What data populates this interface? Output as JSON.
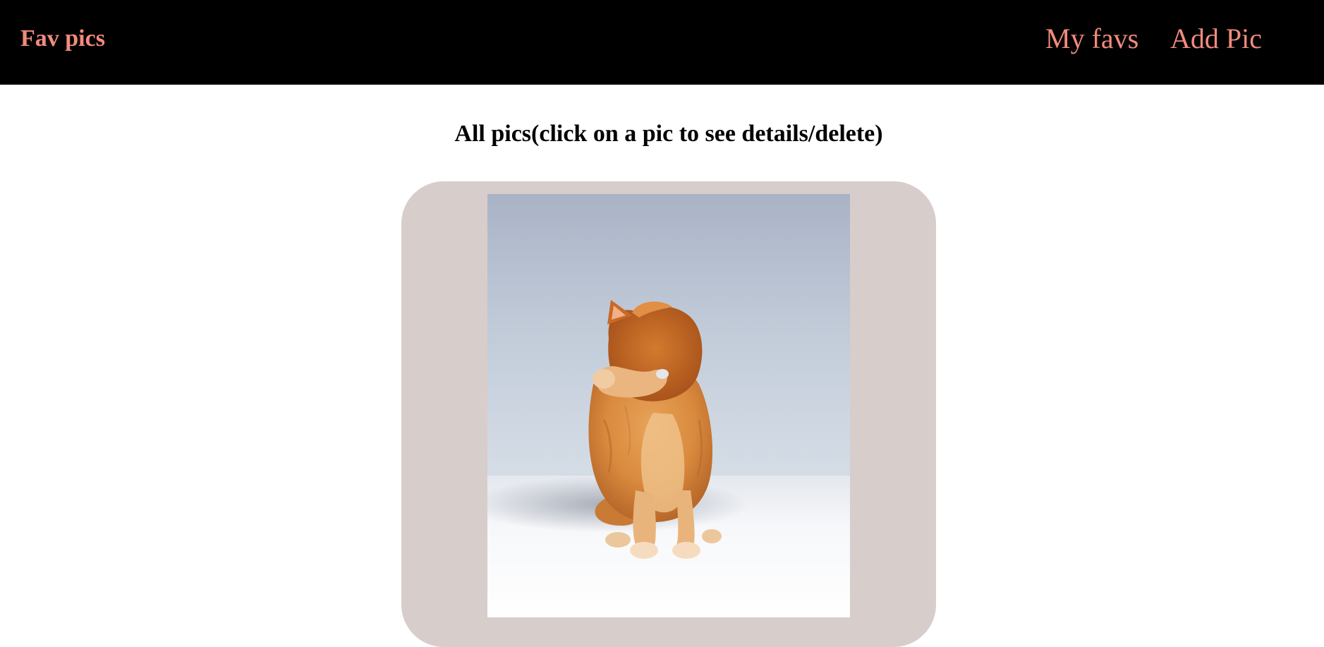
{
  "navbar": {
    "brand": "Fav pics",
    "links": [
      {
        "label": "My favs"
      },
      {
        "label": "Add Pic"
      }
    ]
  },
  "main": {
    "title": "All pics(click on a pic to see details/delete)"
  },
  "colors": {
    "navbar_bg": "#000000",
    "nav_text": "#f28b7d",
    "card_bg": "#d7cdcb"
  },
  "gallery": [
    {
      "image": "cat-covering-face-photo"
    }
  ]
}
